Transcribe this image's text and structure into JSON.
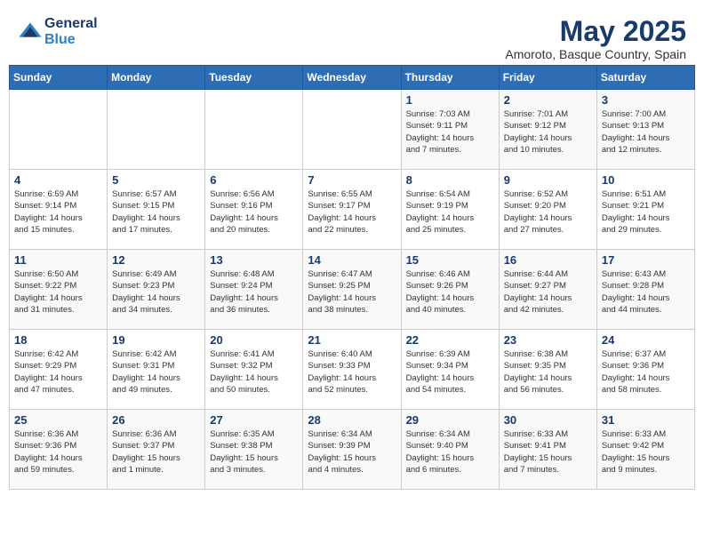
{
  "logo": {
    "line1": "General",
    "line2": "Blue"
  },
  "title": "May 2025",
  "location": "Amoroto, Basque Country, Spain",
  "days_of_week": [
    "Sunday",
    "Monday",
    "Tuesday",
    "Wednesday",
    "Thursday",
    "Friday",
    "Saturday"
  ],
  "weeks": [
    [
      {
        "day": "",
        "info": ""
      },
      {
        "day": "",
        "info": ""
      },
      {
        "day": "",
        "info": ""
      },
      {
        "day": "",
        "info": ""
      },
      {
        "day": "1",
        "info": "Sunrise: 7:03 AM\nSunset: 9:11 PM\nDaylight: 14 hours\nand 7 minutes."
      },
      {
        "day": "2",
        "info": "Sunrise: 7:01 AM\nSunset: 9:12 PM\nDaylight: 14 hours\nand 10 minutes."
      },
      {
        "day": "3",
        "info": "Sunrise: 7:00 AM\nSunset: 9:13 PM\nDaylight: 14 hours\nand 12 minutes."
      }
    ],
    [
      {
        "day": "4",
        "info": "Sunrise: 6:59 AM\nSunset: 9:14 PM\nDaylight: 14 hours\nand 15 minutes."
      },
      {
        "day": "5",
        "info": "Sunrise: 6:57 AM\nSunset: 9:15 PM\nDaylight: 14 hours\nand 17 minutes."
      },
      {
        "day": "6",
        "info": "Sunrise: 6:56 AM\nSunset: 9:16 PM\nDaylight: 14 hours\nand 20 minutes."
      },
      {
        "day": "7",
        "info": "Sunrise: 6:55 AM\nSunset: 9:17 PM\nDaylight: 14 hours\nand 22 minutes."
      },
      {
        "day": "8",
        "info": "Sunrise: 6:54 AM\nSunset: 9:19 PM\nDaylight: 14 hours\nand 25 minutes."
      },
      {
        "day": "9",
        "info": "Sunrise: 6:52 AM\nSunset: 9:20 PM\nDaylight: 14 hours\nand 27 minutes."
      },
      {
        "day": "10",
        "info": "Sunrise: 6:51 AM\nSunset: 9:21 PM\nDaylight: 14 hours\nand 29 minutes."
      }
    ],
    [
      {
        "day": "11",
        "info": "Sunrise: 6:50 AM\nSunset: 9:22 PM\nDaylight: 14 hours\nand 31 minutes."
      },
      {
        "day": "12",
        "info": "Sunrise: 6:49 AM\nSunset: 9:23 PM\nDaylight: 14 hours\nand 34 minutes."
      },
      {
        "day": "13",
        "info": "Sunrise: 6:48 AM\nSunset: 9:24 PM\nDaylight: 14 hours\nand 36 minutes."
      },
      {
        "day": "14",
        "info": "Sunrise: 6:47 AM\nSunset: 9:25 PM\nDaylight: 14 hours\nand 38 minutes."
      },
      {
        "day": "15",
        "info": "Sunrise: 6:46 AM\nSunset: 9:26 PM\nDaylight: 14 hours\nand 40 minutes."
      },
      {
        "day": "16",
        "info": "Sunrise: 6:44 AM\nSunset: 9:27 PM\nDaylight: 14 hours\nand 42 minutes."
      },
      {
        "day": "17",
        "info": "Sunrise: 6:43 AM\nSunset: 9:28 PM\nDaylight: 14 hours\nand 44 minutes."
      }
    ],
    [
      {
        "day": "18",
        "info": "Sunrise: 6:42 AM\nSunset: 9:29 PM\nDaylight: 14 hours\nand 47 minutes."
      },
      {
        "day": "19",
        "info": "Sunrise: 6:42 AM\nSunset: 9:31 PM\nDaylight: 14 hours\nand 49 minutes."
      },
      {
        "day": "20",
        "info": "Sunrise: 6:41 AM\nSunset: 9:32 PM\nDaylight: 14 hours\nand 50 minutes."
      },
      {
        "day": "21",
        "info": "Sunrise: 6:40 AM\nSunset: 9:33 PM\nDaylight: 14 hours\nand 52 minutes."
      },
      {
        "day": "22",
        "info": "Sunrise: 6:39 AM\nSunset: 9:34 PM\nDaylight: 14 hours\nand 54 minutes."
      },
      {
        "day": "23",
        "info": "Sunrise: 6:38 AM\nSunset: 9:35 PM\nDaylight: 14 hours\nand 56 minutes."
      },
      {
        "day": "24",
        "info": "Sunrise: 6:37 AM\nSunset: 9:36 PM\nDaylight: 14 hours\nand 58 minutes."
      }
    ],
    [
      {
        "day": "25",
        "info": "Sunrise: 6:36 AM\nSunset: 9:36 PM\nDaylight: 14 hours\nand 59 minutes."
      },
      {
        "day": "26",
        "info": "Sunrise: 6:36 AM\nSunset: 9:37 PM\nDaylight: 15 hours\nand 1 minute."
      },
      {
        "day": "27",
        "info": "Sunrise: 6:35 AM\nSunset: 9:38 PM\nDaylight: 15 hours\nand 3 minutes."
      },
      {
        "day": "28",
        "info": "Sunrise: 6:34 AM\nSunset: 9:39 PM\nDaylight: 15 hours\nand 4 minutes."
      },
      {
        "day": "29",
        "info": "Sunrise: 6:34 AM\nSunset: 9:40 PM\nDaylight: 15 hours\nand 6 minutes."
      },
      {
        "day": "30",
        "info": "Sunrise: 6:33 AM\nSunset: 9:41 PM\nDaylight: 15 hours\nand 7 minutes."
      },
      {
        "day": "31",
        "info": "Sunrise: 6:33 AM\nSunset: 9:42 PM\nDaylight: 15 hours\nand 9 minutes."
      }
    ]
  ]
}
